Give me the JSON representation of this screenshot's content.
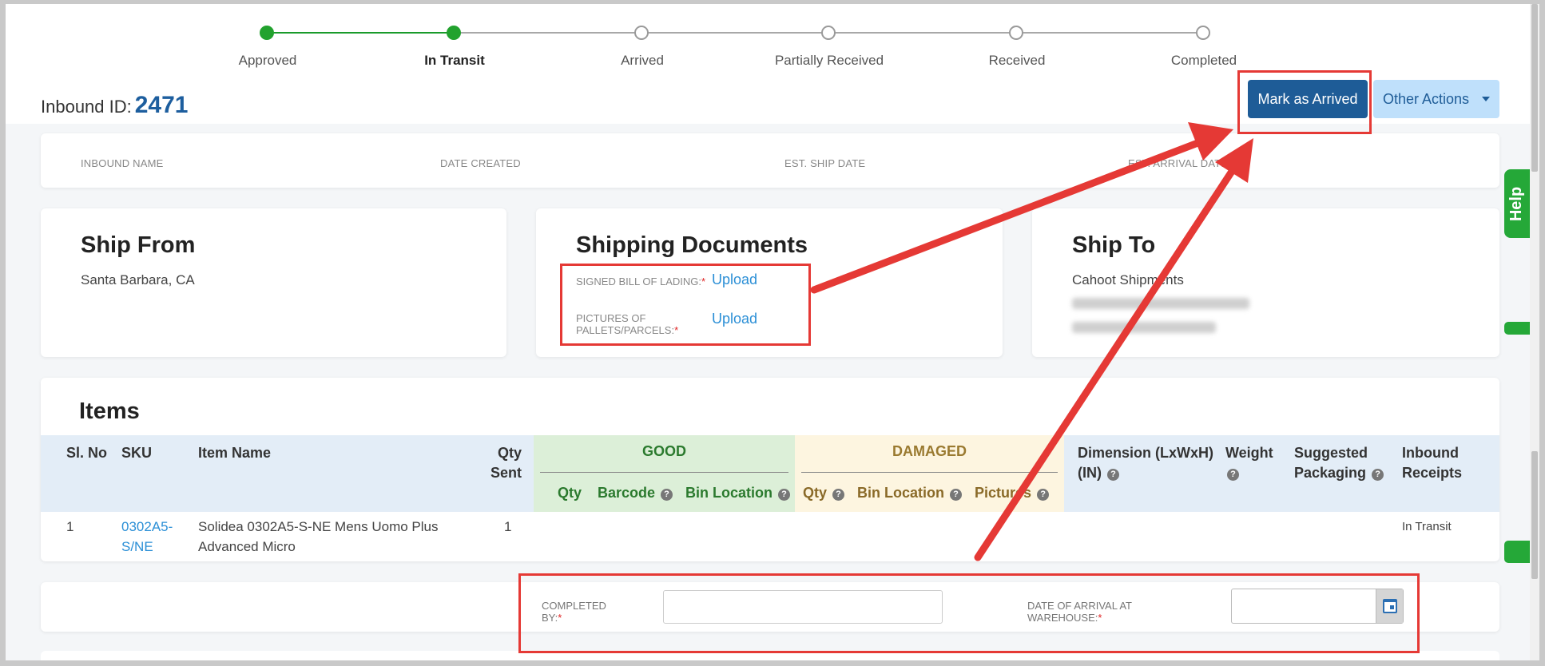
{
  "stepper": {
    "steps": [
      {
        "label": "Approved",
        "status": "done"
      },
      {
        "label": "In Transit",
        "status": "current"
      },
      {
        "label": "Arrived",
        "status": "pending"
      },
      {
        "label": "Partially Received",
        "status": "pending"
      },
      {
        "label": "Received",
        "status": "pending"
      },
      {
        "label": "Completed",
        "status": "pending"
      }
    ]
  },
  "header": {
    "inbound_label": "Inbound ID:",
    "inbound_id": "2471",
    "mark_arrived_label": "Mark as Arrived",
    "other_actions_label": "Other Actions"
  },
  "info": {
    "inbound_name": "INBOUND NAME",
    "date_created": "DATE CREATED",
    "est_ship_date": "EST. SHIP DATE",
    "est_arrival_date": "EST. ARRIVAL DATE"
  },
  "ship_from": {
    "title": "Ship From",
    "location": "Santa Barbara, CA"
  },
  "shipping_documents": {
    "title": "Shipping Documents",
    "signed_bol_label": "SIGNED BILL OF LADING:",
    "pictures_label_line1": "PICTURES OF",
    "pictures_label_line2": "PALLETS/PARCELS:",
    "required_mark": "*",
    "upload_label": "Upload"
  },
  "ship_to": {
    "title": "Ship To",
    "name": "Cahoot Shipments"
  },
  "items": {
    "title": "Items",
    "columns": {
      "sl_no": "Sl. No",
      "sku": "SKU",
      "item_name": "Item Name",
      "qty_sent_line1": "Qty",
      "qty_sent_line2": "Sent",
      "good": "GOOD",
      "damaged": "DAMAGED",
      "qty": "Qty",
      "barcode": "Barcode",
      "bin_location": "Bin Location",
      "pictures": "Pictures",
      "dimension_line1": "Dimension (LxWxH)",
      "dimension_line2": "(IN)",
      "weight": "Weight",
      "suggested_line1": "Suggested",
      "suggested_line2": "Packaging",
      "receipts_line1": "Inbound",
      "receipts_line2": "Receipts"
    },
    "rows": [
      {
        "sl_no": "1",
        "sku_line1": "0302A5-",
        "sku_line2": "S/NE",
        "name_line1": "Solidea 0302A5-S-NE Mens Uomo Plus",
        "name_line2": "Advanced Micro",
        "qty_sent": "1",
        "receipt_status": "In Transit"
      }
    ]
  },
  "completion": {
    "completed_by_line1": "COMPLETED",
    "completed_by_line2": "BY:",
    "arrival_date_line1": "DATE OF ARRIVAL AT",
    "arrival_date_line2": "WAREHOUSE:",
    "required_mark": "*",
    "completed_by_value": "",
    "arrival_date_value": ""
  },
  "help": {
    "label": "Help"
  },
  "colors": {
    "primary": "#1e5c97",
    "done_green": "#22a22e",
    "annotation_red": "#e53935",
    "link_blue": "#2b8fd6"
  }
}
